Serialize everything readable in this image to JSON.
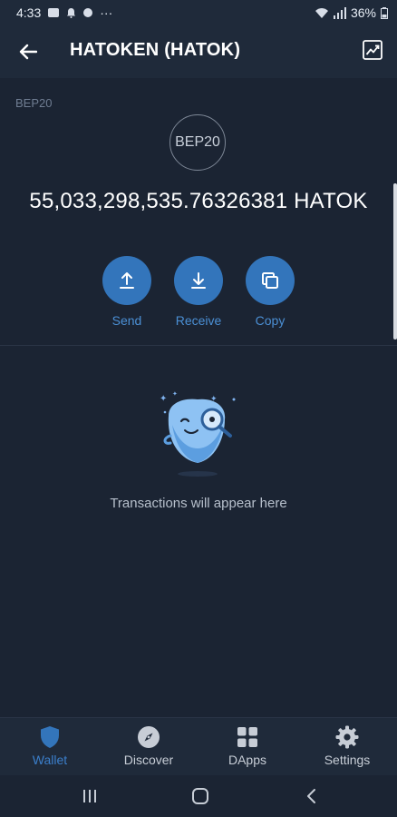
{
  "status_bar": {
    "time": "4:33",
    "more": "···",
    "battery": "36%"
  },
  "header": {
    "title": "HATOKEN (HATOK)",
    "back_icon": "arrow-left-icon",
    "chart_icon": "price-chart-icon"
  },
  "token": {
    "network": "BEP20",
    "logo_text": "BEP20",
    "balance": "55,033,298,535.76326381 HATOK"
  },
  "actions": [
    {
      "label": "Send",
      "icon": "upload-icon"
    },
    {
      "label": "Receive",
      "icon": "download-icon"
    },
    {
      "label": "Copy",
      "icon": "copy-icon"
    }
  ],
  "empty_state": {
    "message": "Transactions will appear here",
    "icon": "magnifier-mascot-icon"
  },
  "bottom_nav": [
    {
      "label": "Wallet",
      "icon": "shield-icon",
      "active": true
    },
    {
      "label": "Discover",
      "icon": "compass-icon",
      "active": false
    },
    {
      "label": "DApps",
      "icon": "grid-icon",
      "active": false
    },
    {
      "label": "Settings",
      "icon": "gear-icon",
      "active": false
    }
  ],
  "colors": {
    "background": "#1b2433",
    "header": "#1f2a3a",
    "accent": "#3375bb",
    "active_nav": "#3b7fcb",
    "muted_text": "#6f7d92"
  }
}
